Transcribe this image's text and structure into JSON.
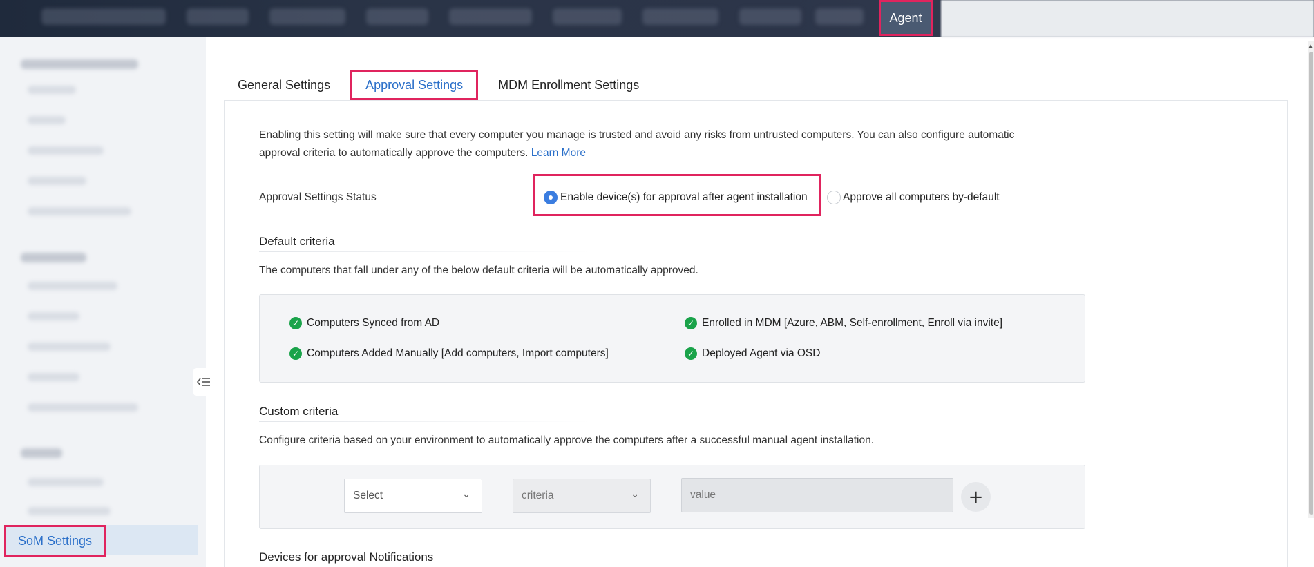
{
  "header": {
    "agent_label": "Agent"
  },
  "sidebar": {
    "active_item": "SoM Settings",
    "collapse_icon": "collapse-sidebar-icon"
  },
  "tabs": [
    {
      "label": "General Settings"
    },
    {
      "label": "Approval Settings"
    },
    {
      "label": "MDM Enrollment Settings"
    }
  ],
  "intro": {
    "text": "Enabling this setting will make sure that every computer you manage is trusted and avoid any risks from untrusted computers. You can also configure automatic approval criteria to automatically approve the computers.",
    "link": "Learn More"
  },
  "approval_status": {
    "label": "Approval Settings Status",
    "option_enable": "Enable device(s) for approval after agent installation",
    "option_approve_all": "Approve all computers by-default",
    "selected": "Enable device(s) for approval after agent installation"
  },
  "default_criteria": {
    "title": "Default criteria",
    "description": "The computers that fall under any of the below default criteria will be automatically approved.",
    "items": [
      "Computers Synced from AD",
      "Computers Added Manually [Add computers, Import computers]",
      "Enrolled in MDM [Azure, ABM, Self-enrollment, Enroll via invite]",
      "Deployed Agent via OSD"
    ]
  },
  "custom_criteria": {
    "title": "Custom criteria",
    "description": "Configure criteria based on your environment to automatically approve the computers after a successful manual agent installation.",
    "select_placeholder": "Select",
    "criteria_placeholder": "criteria",
    "value_placeholder": "value"
  },
  "notifications": {
    "title": "Devices for approval Notifications"
  },
  "colors": {
    "accent": "#2a6fc9",
    "highlight": "#e0245e",
    "success": "#1aa34a"
  }
}
